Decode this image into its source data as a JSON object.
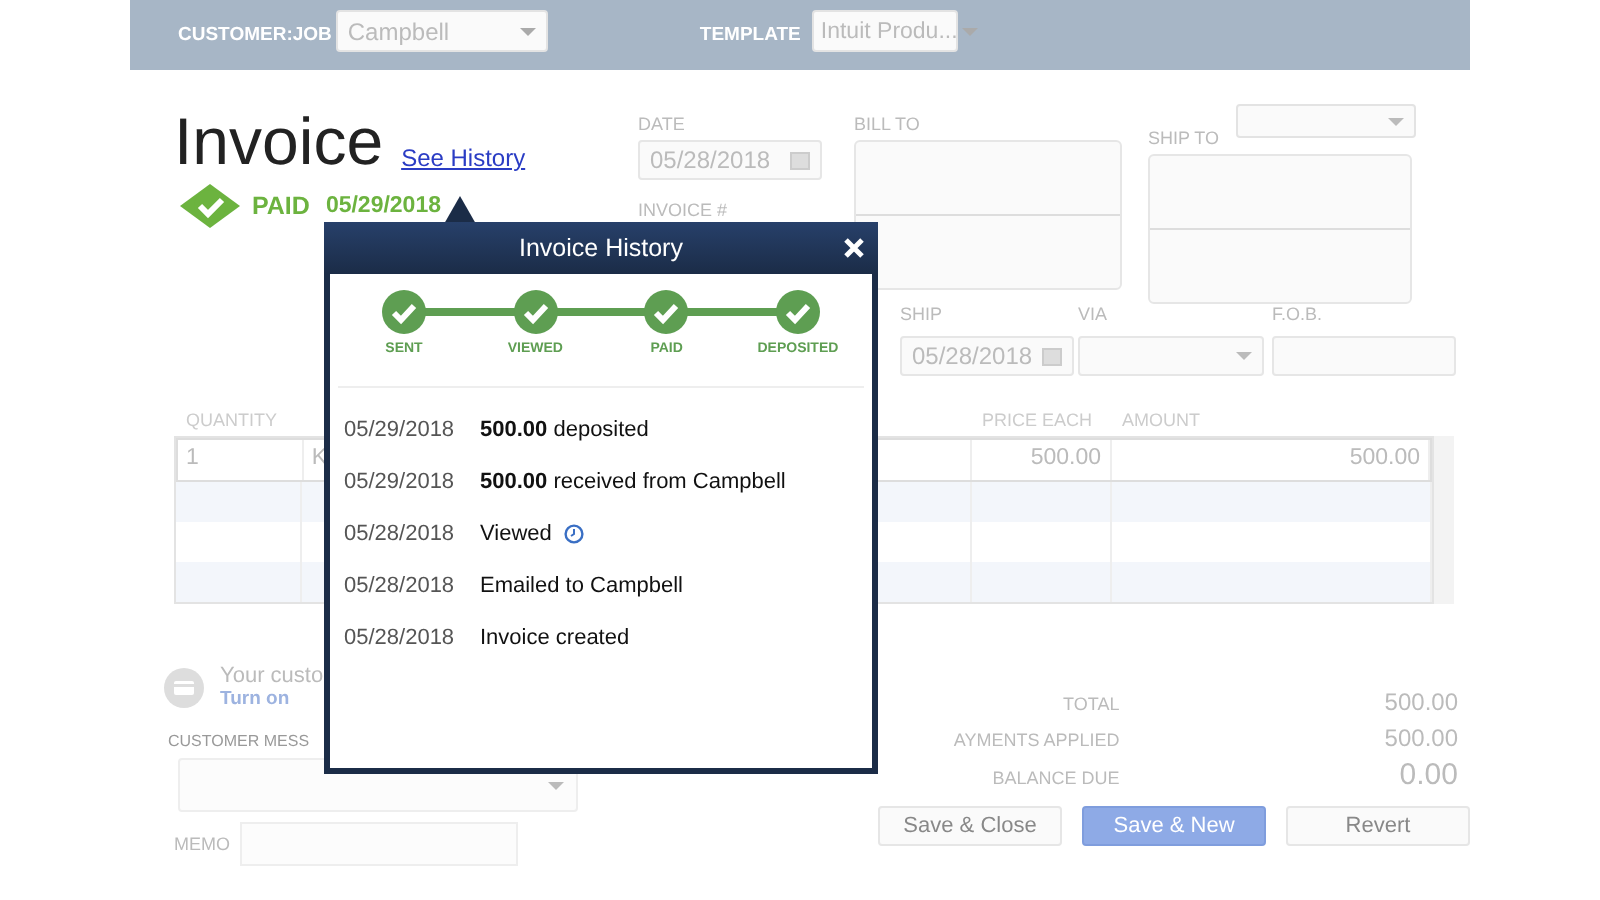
{
  "header": {
    "customer_job_label": "CUSTOMER:JOB",
    "customer_job": "Campbell",
    "template_label": "TEMPLATE",
    "template": "Intuit Produ..."
  },
  "invoice": {
    "title": "Invoice",
    "history_link": "See History",
    "status": "PAID",
    "status_date": "05/29/2018"
  },
  "fields": {
    "date_label": "DATE",
    "date": "05/28/2018",
    "invoice_number_label": "INVOICE #",
    "bill_to_label": "BILL TO",
    "ship_to_label": "SHIP TO",
    "ship_label": "SHIP",
    "ship_date": "05/28/2018",
    "via_label": "VIA",
    "fob_label": "F.O.B."
  },
  "table": {
    "columns": [
      "QUANTITY",
      "PRICE EACH",
      "AMOUNT"
    ],
    "rows": [
      {
        "quantity": "1",
        "item": "K",
        "price_each": "500.00",
        "amount": "500.00"
      }
    ]
  },
  "payments": {
    "notice": "Your custo",
    "link": "Turn on"
  },
  "customer_message_label": "CUSTOMER MESS",
  "memo_label": "MEMO",
  "totals": [
    {
      "label": "TOTAL",
      "value": "500.00",
      "kind": "normal"
    },
    {
      "label": "AYMENTS APPLIED",
      "value": "500.00",
      "kind": "normal"
    },
    {
      "label": "BALANCE DUE",
      "value": "0.00",
      "kind": "balance"
    }
  ],
  "buttons": [
    {
      "label": "Save & Close",
      "primary": false
    },
    {
      "label": "Save & New",
      "primary": true
    },
    {
      "label": "Revert",
      "primary": false
    }
  ],
  "history": {
    "title": "Invoice History",
    "steps": [
      {
        "label": "SENT",
        "done": true
      },
      {
        "label": "VIEWED",
        "done": true
      },
      {
        "label": "PAID",
        "done": true
      },
      {
        "label": "DEPOSITED",
        "done": true
      }
    ],
    "events": [
      {
        "date": "05/29/2018",
        "text": "**500.00** deposited",
        "kind": "plain"
      },
      {
        "date": "05/29/2018",
        "text": "**500.00** received from Campbell",
        "kind": "plain"
      },
      {
        "date": "05/28/2018",
        "text": "Viewed",
        "kind": "viewed"
      },
      {
        "date": "05/28/2018",
        "text": "Emailed to Campbell",
        "kind": "plain"
      },
      {
        "date": "05/28/2018",
        "text": "Invoice created",
        "kind": "plain"
      }
    ]
  }
}
